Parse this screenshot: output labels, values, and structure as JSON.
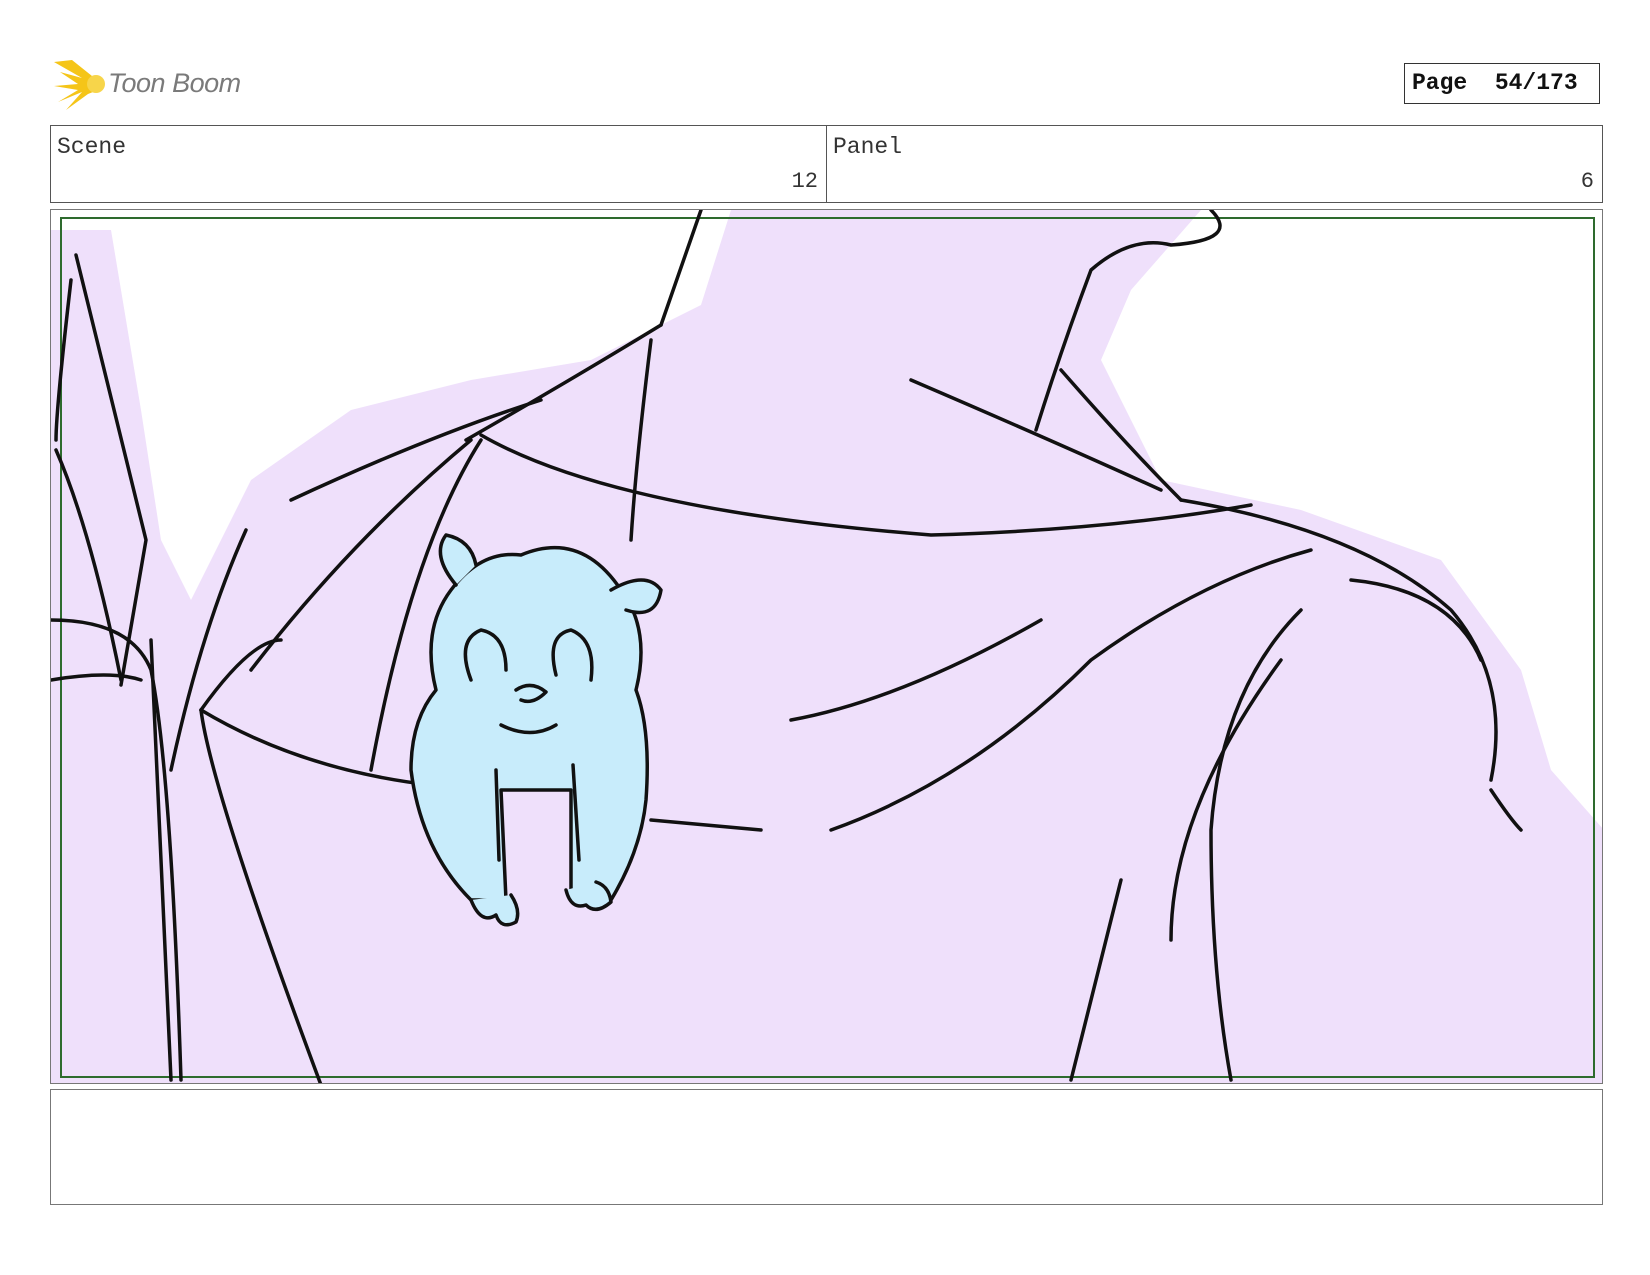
{
  "header": {
    "logo_text": "Toon Boom",
    "page_label": "Page",
    "page_value": "54/173"
  },
  "scene": {
    "label": "Scene",
    "value": "12"
  },
  "panel": {
    "label": "Panel",
    "value": "6"
  },
  "colors": {
    "shirt_fill": "#efe0fb",
    "hamster_fill": "#c8ecfb",
    "safe_frame": "#2e6b2e",
    "logo_yellow": "#f5c518",
    "ink": "#111111"
  },
  "drawing": {
    "subject": "hamster-on-shoulder-sketch"
  },
  "caption": {
    "text": ""
  }
}
